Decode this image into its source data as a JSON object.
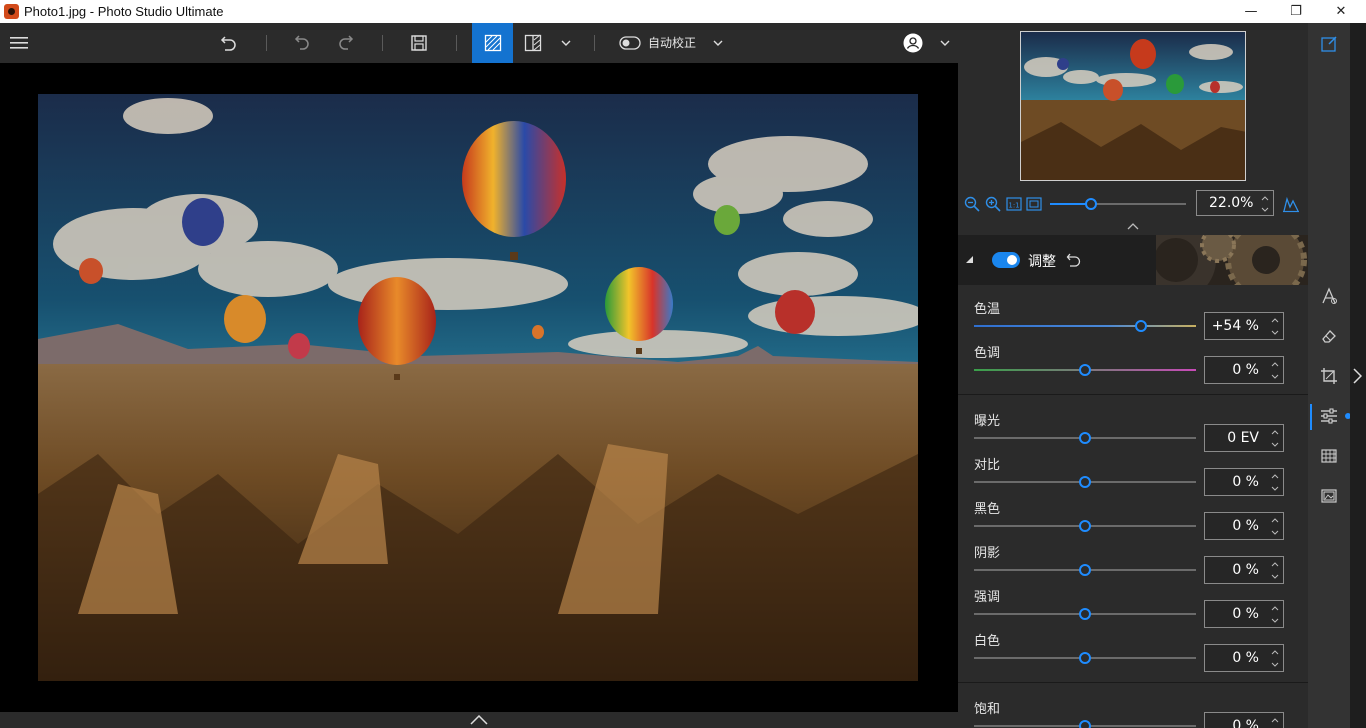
{
  "window": {
    "title": "Photo1.jpg - Photo Studio Ultimate",
    "minimize": "—",
    "restore": "❐",
    "close": "✕"
  },
  "toolbar": {
    "auto_fix_label": "自动校正"
  },
  "navigator": {
    "zoom_value": "22.0%",
    "zoom_fraction": 0.3
  },
  "adjust": {
    "title": "调整",
    "enabled": true,
    "items": [
      {
        "label": "色温",
        "value": "+54 %",
        "slider": 0.75,
        "track": "temperature"
      },
      {
        "label": "色调",
        "value": "0 %",
        "slider": 0.5,
        "track": "tint"
      },
      {
        "label": "曝光",
        "value": "0 EV",
        "slider": 0.5,
        "track": "plain"
      },
      {
        "label": "对比",
        "value": "0 %",
        "slider": 0.5,
        "track": "plain"
      },
      {
        "label": "黑色",
        "value": "0 %",
        "slider": 0.5,
        "track": "plain"
      },
      {
        "label": "阴影",
        "value": "0 %",
        "slider": 0.5,
        "track": "plain"
      },
      {
        "label": "强调",
        "value": "0 %",
        "slider": 0.5,
        "track": "plain"
      },
      {
        "label": "白色",
        "value": "0 %",
        "slider": 0.5,
        "track": "plain"
      },
      {
        "label": "饱和",
        "value": "0 %",
        "slider": 0.5,
        "track": "plain"
      }
    ]
  },
  "colors": {
    "accent": "#1473d0",
    "slider_accent": "#1f8cff",
    "toggle_on": "#1a86ee"
  },
  "side_icons": [
    "edit-icon",
    "style-icon",
    "eraser-icon",
    "crop-icon",
    "adjust-sliders-icon",
    "grid-icon",
    "frame-icon"
  ]
}
